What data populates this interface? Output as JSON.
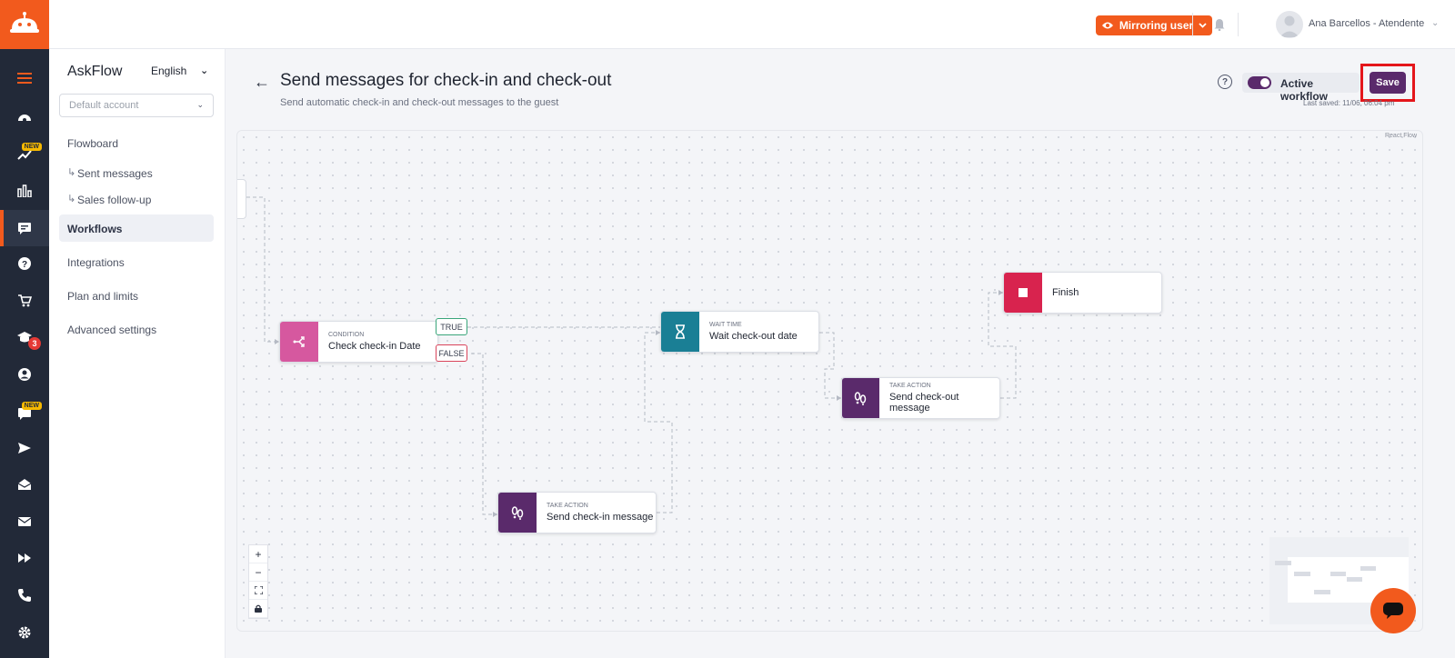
{
  "topbar": {
    "mirroring_label": "Mirroring user",
    "user_name": "Ana Barcellos - Atendente"
  },
  "rail": {
    "items": [
      {
        "icon": "menu-icon"
      },
      {
        "icon": "dashboard-icon"
      },
      {
        "icon": "trending-icon",
        "badge": "NEW"
      },
      {
        "icon": "bar-chart-icon"
      },
      {
        "icon": "chat-flow-icon",
        "active": true
      },
      {
        "icon": "help-icon"
      },
      {
        "icon": "cart-icon"
      },
      {
        "icon": "school-icon",
        "badge_count": "3"
      },
      {
        "icon": "user-icon"
      },
      {
        "icon": "comment-icon",
        "badge": "NEW"
      },
      {
        "icon": "send-icon"
      },
      {
        "icon": "inbox-icon"
      },
      {
        "icon": "mail-icon"
      },
      {
        "icon": "fast-forward-icon"
      },
      {
        "icon": "phone-icon"
      },
      {
        "icon": "settings-icon"
      }
    ],
    "badge_new": "NEW",
    "badge_count": "3"
  },
  "sidemenu": {
    "app_title": "AskFlow",
    "language": "English",
    "account_placeholder": "Default account",
    "items": {
      "flowboard": "Flowboard",
      "sent_messages": "Sent messages",
      "sales_followup": "Sales follow-up",
      "workflows": "Workflows",
      "integrations": "Integrations",
      "plan_limits": "Plan and limits",
      "advanced_settings": "Advanced settings"
    },
    "sub_arrow": "↳"
  },
  "header": {
    "title": "Send messages for check-in and check-out",
    "subtitle": "Send automatic check-in and check-out messages to the guest",
    "toggle_label": "Active workflow",
    "toggle_on": true,
    "save_label": "Save",
    "last_saved": "Last saved: 11/06, 06:04 pm"
  },
  "canvas": {
    "attribution": "React Flow",
    "nodes": {
      "condition": {
        "kind": "CONDITION",
        "label": "Check check-in Date",
        "color": "#d6589f"
      },
      "wait": {
        "kind": "WAIT TIME",
        "label": "Wait check-out date",
        "color": "#1a7f95"
      },
      "finish": {
        "kind": "",
        "label": "Finish",
        "color": "#d8234e"
      },
      "checkout": {
        "kind": "TAKE ACTION",
        "label": "Send check-out message",
        "color": "#5a2a6b"
      },
      "checkin": {
        "kind": "TAKE ACTION",
        "label": "Send check-in message",
        "color": "#5a2a6b"
      }
    },
    "branch_true": "TRUE",
    "branch_false": "FALSE",
    "controls": {
      "zoom_in": "+",
      "zoom_out": "−"
    }
  },
  "colors": {
    "brand": "#f25a1d",
    "rail": "#222938",
    "accent": "#5a2a6b",
    "highlight": "#e4161b"
  }
}
